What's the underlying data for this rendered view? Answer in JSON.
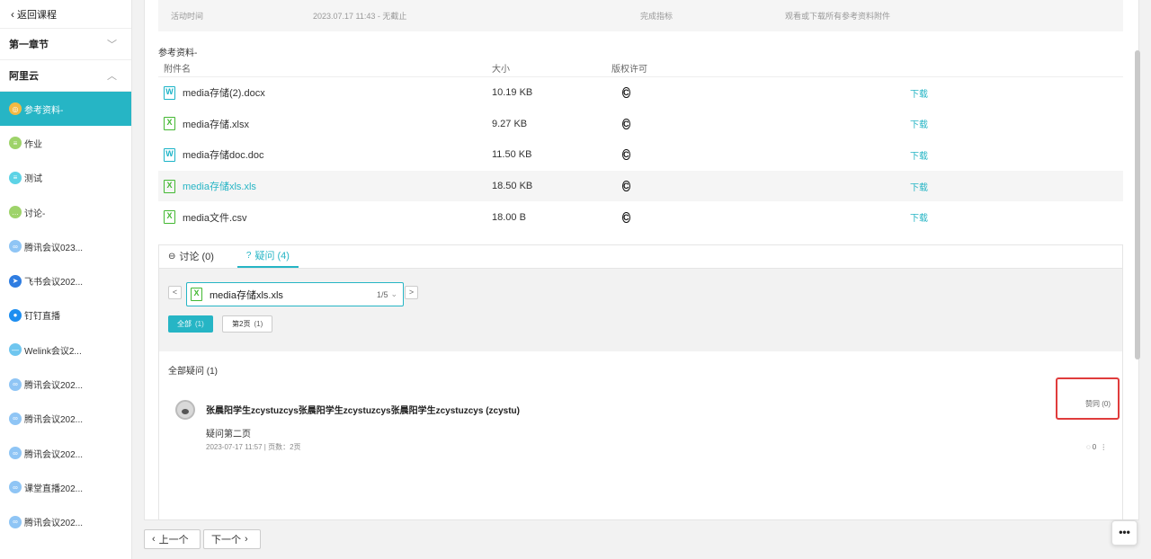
{
  "sidebar": {
    "back_label": "返回课程",
    "chapters": [
      {
        "label": "第一章节",
        "caret": "﹀"
      },
      {
        "label": "阿里云",
        "caret": "︿"
      }
    ],
    "items": [
      {
        "label": "参考资料-",
        "icon": "reference-icon",
        "active": true
      },
      {
        "label": "作业",
        "icon": "homework-icon"
      },
      {
        "label": "测试",
        "icon": "test-icon"
      },
      {
        "label": "讨论-",
        "icon": "discussion-icon"
      },
      {
        "label": "腾讯会议023...",
        "icon": "tencent-meeting-icon"
      },
      {
        "label": "飞书会议202...",
        "icon": "feishu-icon"
      },
      {
        "label": "钉钉直播",
        "icon": "dingtalk-icon"
      },
      {
        "label": "Welink会议2...",
        "icon": "welink-icon"
      },
      {
        "label": "腾讯会议202...",
        "icon": "tencent-meeting-icon"
      },
      {
        "label": "腾讯会议202...",
        "icon": "tencent-meeting-icon"
      },
      {
        "label": "腾讯会议202...",
        "icon": "tencent-meeting-icon"
      },
      {
        "label": "课堂直播202...",
        "icon": "live-class-icon"
      },
      {
        "label": "腾讯会议202...",
        "icon": "tencent-meeting-icon"
      }
    ]
  },
  "top_strip": {
    "activity_label": "活动时间",
    "activity_value": "2023.07.17 11:43 - 无截止",
    "completion_label": "完成指标",
    "completion_value": "观看或下载所有参考资料附件"
  },
  "references": {
    "title": "参考资料-",
    "columns": [
      "附件名",
      "大小",
      "版权许可",
      ""
    ],
    "rows": [
      {
        "type": "W",
        "name": "media存储(2).docx",
        "size": "10.19 KB",
        "action": "下载"
      },
      {
        "type": "X",
        "name": "media存储.xlsx",
        "size": "9.27 KB",
        "action": "下载"
      },
      {
        "type": "W",
        "name": "media存储doc.doc",
        "size": "11.50 KB",
        "action": "下载"
      },
      {
        "type": "X",
        "name": "media存储xls.xls",
        "size": "18.50 KB",
        "action": "下载"
      },
      {
        "type": "X",
        "name": "media文件.csv",
        "size": "18.00 B",
        "action": "下载"
      }
    ],
    "copyright_glyph": "C"
  },
  "qa": {
    "tabs": [
      {
        "label": "讨论 (0)",
        "icon": "⊖"
      },
      {
        "label": "疑问 (4)",
        "icon": "?"
      }
    ],
    "file_selector": {
      "name": "media存储xls.xls",
      "count": "1/5",
      "prev": "<",
      "next": ">"
    },
    "filters": [
      {
        "label": "全部",
        "count": "(1)"
      },
      {
        "label": "第2页",
        "count": "(1)"
      }
    ],
    "all_label": "全部疑问 (1)",
    "question": {
      "author": "张晨阳学生zcystuzcys张晨阳学生zcystuzcys张晨阳学生zcystuzcys (zcystu)",
      "text": "疑问第二页",
      "meta": "2023-07-17 11:57  |  页数：2页",
      "like": "赞同 (0)",
      "comments": "0"
    }
  },
  "pager": {
    "prev": "上一个",
    "next": "下一个"
  },
  "fab_label": "•••"
}
